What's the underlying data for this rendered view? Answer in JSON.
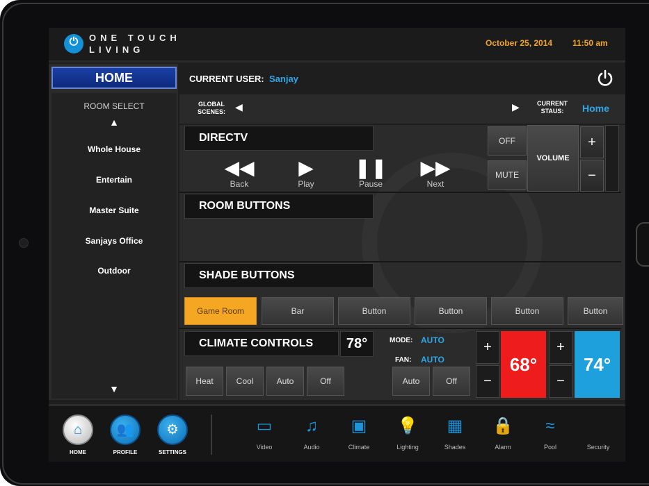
{
  "brand": {
    "line1": "ONE TOUCH",
    "line2": "LIVING"
  },
  "header": {
    "date": "October 25, 2014",
    "time": "11:50 am"
  },
  "sidebar": {
    "home_label": "HOME",
    "room_select": "ROOM SELECT",
    "rooms": [
      "Whole House",
      "Entertain",
      "Master Suite",
      "Sanjays Office",
      "Outdoor"
    ]
  },
  "user": {
    "label": "CURRENT USER:",
    "name": "Sanjay"
  },
  "scenes": {
    "label_line1": "GLOBAL",
    "label_line2": "SCENES:",
    "status_line1": "CURRENT",
    "status_line2": "STAUS:",
    "status_value": "Home"
  },
  "directv": {
    "title": "DIRECTV",
    "transport": [
      {
        "label": "Back",
        "icon": "rewind-icon"
      },
      {
        "label": "Play",
        "icon": "play-icon"
      },
      {
        "label": "Pause",
        "icon": "pause-icon"
      },
      {
        "label": "Next",
        "icon": "fast-forward-icon"
      }
    ],
    "off": "OFF",
    "mute": "MUTE",
    "volume": "VOLUME",
    "plus": "+",
    "minus": "−"
  },
  "room_buttons": {
    "title": "ROOM BUTTONS"
  },
  "shade_buttons": {
    "title": "SHADE BUTTONS",
    "buttons": [
      "Game Room",
      "Bar",
      "Button",
      "Button",
      "Button",
      "Button"
    ],
    "active_index": 0
  },
  "climate": {
    "title": "CLIMATE CONTROLS",
    "current_temp": "78°",
    "mode_label": "MODE:",
    "mode_value": "AUTO",
    "fan_label": "FAN:",
    "fan_value": "AUTO",
    "mode_buttons": [
      "Heat",
      "Cool",
      "Auto",
      "Off"
    ],
    "fan_buttons": [
      "Auto",
      "Off"
    ],
    "heat_setpoint": "68°",
    "cool_setpoint": "74°",
    "colors": {
      "heat": "#ee1c1c",
      "cool": "#1ea0dc",
      "accent": "#f5a623"
    }
  },
  "bottom_nav": {
    "main": [
      {
        "label": "HOME",
        "icon": "house-icon"
      },
      {
        "label": "PROFILE",
        "icon": "users-icon"
      },
      {
        "label": "SETTINGS",
        "icon": "gears-icon"
      }
    ],
    "devices": [
      {
        "label": "Video",
        "icon": "monitor-icon"
      },
      {
        "label": "Audio",
        "icon": "music-note-icon"
      },
      {
        "label": "Climate",
        "icon": "thermostat-icon"
      },
      {
        "label": "Lighting",
        "icon": "bulb-icon"
      },
      {
        "label": "Shades",
        "icon": "window-shade-icon"
      },
      {
        "label": "Alarm",
        "icon": "lock-icon"
      },
      {
        "label": "Pool",
        "icon": "swimmer-icon"
      },
      {
        "label": "Security",
        "icon": "camera-icon"
      }
    ]
  }
}
